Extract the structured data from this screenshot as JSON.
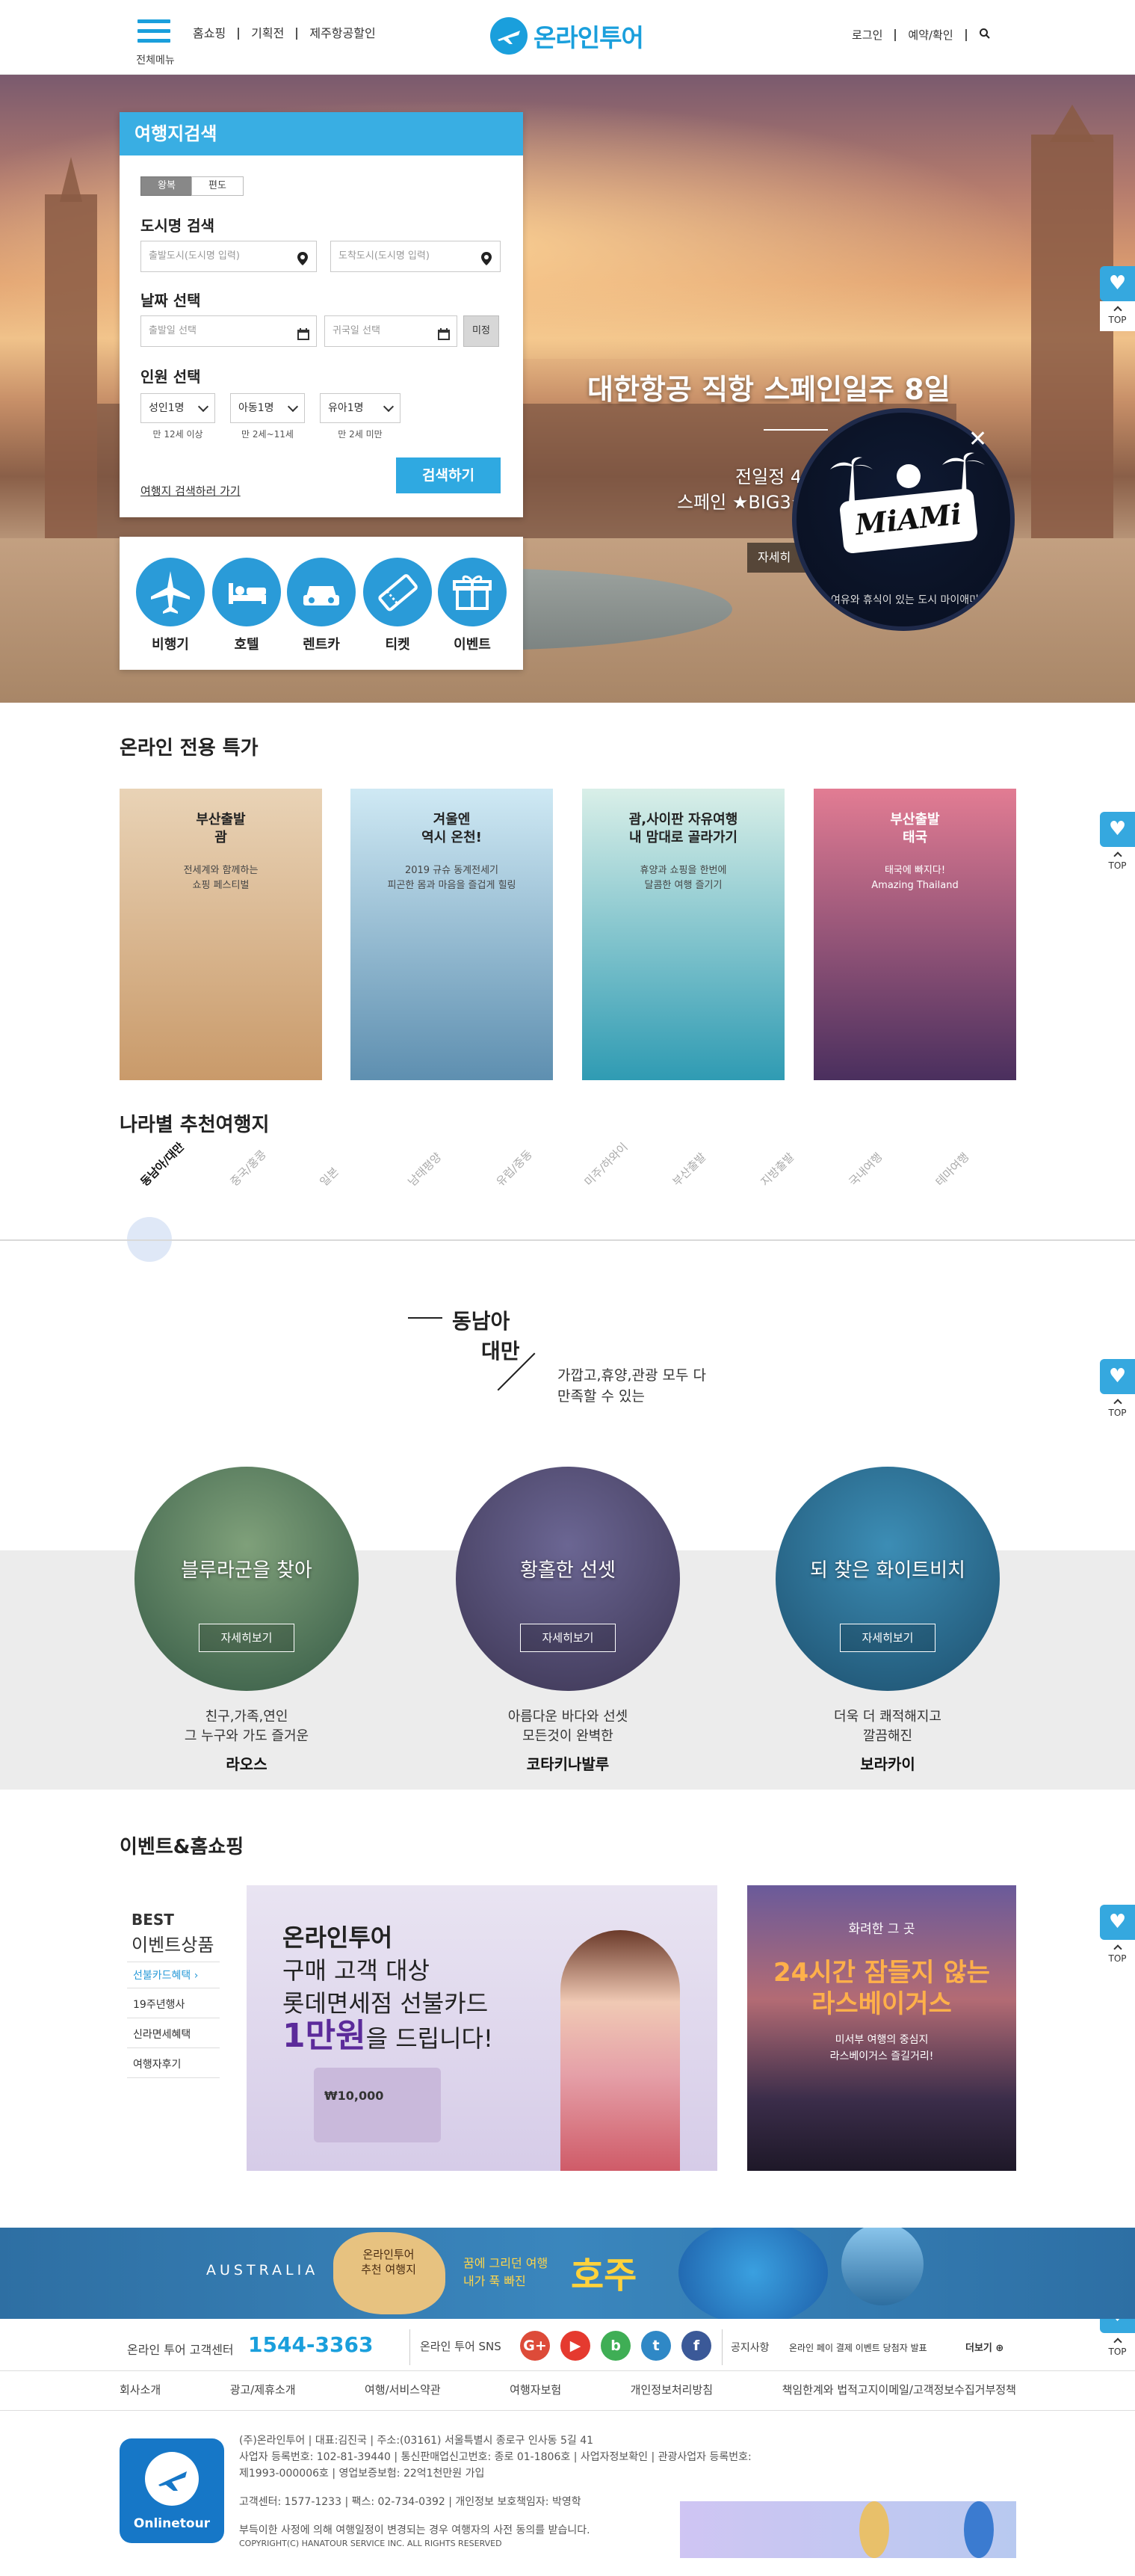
{
  "header": {
    "menu_label": "전체메뉴",
    "nav": [
      "홈쇼핑",
      "기획전",
      "제주항공할인"
    ],
    "logo_text": "온라인투어",
    "util": [
      "로그인",
      "예약/확인"
    ]
  },
  "hero": {
    "title": "대한항공 직항 스페인일주 8일",
    "sub1": "전일정 4성급",
    "sub2": "스페인 ★BIG3★ 도시",
    "more": "자세히"
  },
  "search": {
    "title": "여행지검색",
    "seg_round": "왕복",
    "seg_oneway": "편도",
    "city_label": "도시명 검색",
    "depart_placeholder": "출발도시(도시명 입력)",
    "arrive_placeholder": "도착도시(도시명 입력)",
    "date_label": "날짜 선택",
    "depart_date": "출발일 선택",
    "return_date": "귀국일 선택",
    "undecided": "미정",
    "people_label": "인원 선택",
    "adult": "성인1명",
    "child": "아동1명",
    "infant": "유아1명",
    "adult_note": "만 12세 이상",
    "child_note": "만 2세~11세",
    "infant_note": "만 2세 미만",
    "old_link": "여행지 검색하러 가기",
    "submit": "검색하기"
  },
  "quick": [
    {
      "label": "비행기",
      "icon": "airplane-icon"
    },
    {
      "label": "호텔",
      "icon": "bed-icon"
    },
    {
      "label": "렌트카",
      "icon": "car-icon"
    },
    {
      "label": "티켓",
      "icon": "ticket-icon"
    },
    {
      "label": "이벤트",
      "icon": "gift-icon"
    }
  ],
  "miami": {
    "logo": "MiAMi",
    "caption": "여유와 휴식이 있는 도시 마이애미",
    "close": "✕"
  },
  "float": {
    "heart": "♥",
    "top": "TOP"
  },
  "specials": {
    "title": "온라인 전용 특가",
    "cards": [
      {
        "title": "부산출발\n괌",
        "desc": "전세계와 함께하는\n쇼핑 페스티벌",
        "colors": [
          "#e9d3b6",
          "#c99a6a"
        ]
      },
      {
        "title": "겨울엔\n역시 온천!",
        "desc": "2019 규슈 동계전세기\n피곤한 몸과 마음을 즐겁게 힐링",
        "colors": [
          "#cfe9f4",
          "#5e8fb0"
        ]
      },
      {
        "title": "괌,사이판 자유여행\n내 맘대로 골라가기",
        "desc": "휴양과 쇼핑을 한번에\n달콤한 여행 즐기기",
        "colors": [
          "#d9efe8",
          "#2f9bb3"
        ]
      },
      {
        "title": "부산출발\n태국",
        "desc": "태국에 빠지다!\nAmazing Thailand",
        "colors": [
          "#e27c93",
          "#4a2f5e"
        ]
      }
    ]
  },
  "countries": {
    "title": "나라별 추천여행지",
    "tabs": [
      "동남아/대만",
      "중국/홍콩",
      "일본",
      "남태평양",
      "유럽/중동",
      "미주/하와이",
      "부산출발",
      "지방출발",
      "국내여행",
      "테마여행"
    ]
  },
  "feature": {
    "t1": "동남아",
    "t2": "대만",
    "desc": "가깝고,휴양,관광 모두 다\n만족할 수 있는"
  },
  "destinations": [
    {
      "caption": "블루라군을 찾아",
      "button": "자세히보기",
      "desc": "친구,가족,연인\n그 누구와 가도 즐거운",
      "name": "라오스",
      "colors": [
        "#7fa07a",
        "#355a45"
      ]
    },
    {
      "caption": "황홀한 선셋",
      "button": "자세히보기",
      "desc": "아름다운 바다와 선셋\n모든것이 완벽한",
      "name": "코타키나발루",
      "colors": [
        "#6b6693",
        "#3c3553"
      ]
    },
    {
      "caption": "되 찾은 화이트비치",
      "button": "자세히보기",
      "desc": "더욱 더 쾌적해지고\n깔끔해진",
      "name": "보라카이",
      "colors": [
        "#3c8db5",
        "#1d4f6d"
      ]
    }
  ],
  "events": {
    "title": "이벤트&홈쇼핑",
    "best_t1": "BEST",
    "best_t2": "이벤트상품",
    "best_items": [
      "선불카드혜택",
      "19주년행사",
      "신라면세혜택",
      "여행자후기"
    ],
    "banner1": {
      "l1": "온라인투어",
      "l2": "구매 고객 대상",
      "l3": "롯데면세점 선불카드",
      "big": "1만원",
      "l4": "을 드립니다!",
      "card_value": "₩10,000"
    },
    "banner2": {
      "small": "화려한 그 곳",
      "big": "24시간 잠들지 않는\n라스베이거스",
      "desc": "미서부 여행의 중심지\n라스베이거스 즐길거리!"
    }
  },
  "australia": {
    "word": "AUSTRALIA",
    "map_text": "온라인투어\n추천 여행지",
    "tag": "꿈에 그리던 여행\n내가 푹 빠진",
    "main": "호주"
  },
  "info": {
    "cs_label": "온라인 투어 고객센터",
    "cs_number": "1544-3363",
    "sns_label": "온라인 투어 SNS",
    "sns": [
      {
        "g": "G+",
        "color": "#dd4b39"
      },
      {
        "g": "▶",
        "color": "#e53a2f"
      },
      {
        "g": "b",
        "color": "#3fae55"
      },
      {
        "g": "t",
        "color": "#2f88c6"
      },
      {
        "g": "f",
        "color": "#3b5998"
      }
    ],
    "notice_label": "공지사항",
    "notice_text": "온라인 페이 결제 이벤트 당첨자 발표",
    "notice_more": "더보기"
  },
  "footer": {
    "nav": [
      "회사소개",
      "광고/제휴소개",
      "여행/서비스약관",
      "여행자보험",
      "개인정보처리방침",
      "책임한계와 법적고지이메일/고객정보수집거부정책"
    ],
    "logo": "Onlinetour",
    "lines": [
      "(주)온라인투어 | 대표:김진국 | 주소:(03161) 서울특별시 종로구 인사동 5길 41",
      "사업자 등록번호: 102-81-39440 | 통신판매업신고번호: 종로 01-1806호 | 사업자정보확인 | 관광사업자 등록번호:",
      "제1993-000006호 | 영업보증보험: 22억1천만원 가입",
      "고객센터: 1577-1233 | 팩스: 02-734-0392 | 개인정보 보호책임자: 박영학",
      "부득이한 사정에 의해 여행일정이 변경되는 경우 여행자의 사전 동의를 받습니다.",
      "COPYRIGHT(C) HANATOUR SERVICE INC. ALL RIGHTS RESERVED"
    ]
  }
}
